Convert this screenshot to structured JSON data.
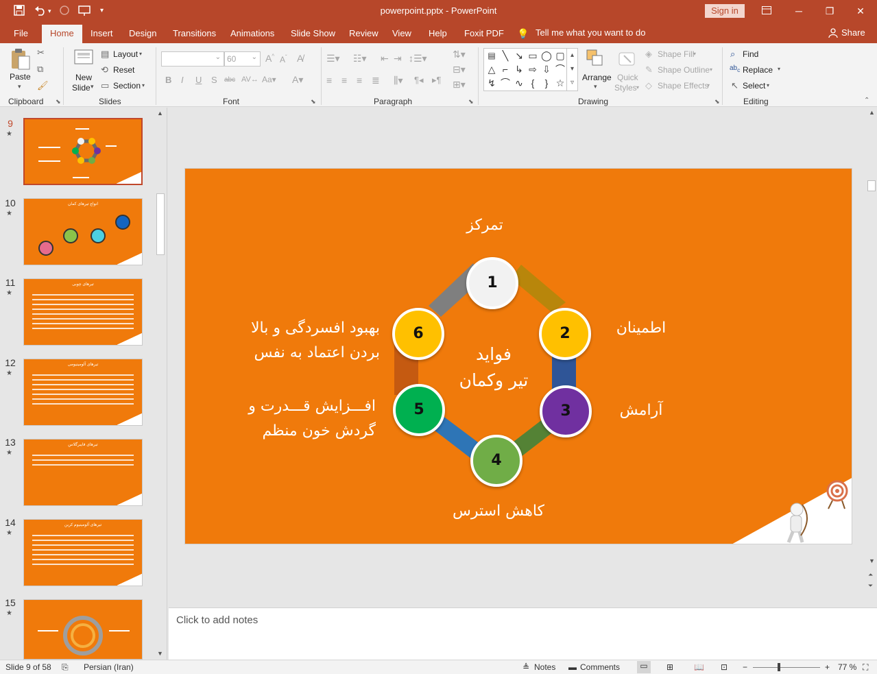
{
  "titlebar": {
    "title": "powerpoint.pptx  -  PowerPoint",
    "sign_in": "Sign in",
    "qat": {
      "save": "save-icon",
      "undo": "undo-icon",
      "redo": "redo-icon",
      "present": "present-icon",
      "more": "customize-icon"
    }
  },
  "tabs": [
    "File",
    "Home",
    "Insert",
    "Design",
    "Transitions",
    "Animations",
    "Slide Show",
    "Review",
    "View",
    "Help",
    "Foxit PDF"
  ],
  "active_tab": "Home",
  "tell_me": "Tell me what you want to do",
  "share": "Share",
  "ribbon": {
    "clipboard": {
      "label": "Clipboard",
      "paste": "Paste"
    },
    "slides": {
      "label": "Slides",
      "new_slide_1": "New",
      "new_slide_2": "Slide",
      "layout": "Layout",
      "reset": "Reset",
      "section": "Section"
    },
    "font": {
      "label": "Font",
      "font_size": "60"
    },
    "paragraph": {
      "label": "Paragraph"
    },
    "drawing": {
      "label": "Drawing",
      "arrange": "Arrange",
      "quick_styles_1": "Quick",
      "quick_styles_2": "Styles",
      "shape_fill": "Shape Fill",
      "shape_outline": "Shape Outline",
      "shape_effects": "Shape Effects"
    },
    "editing": {
      "label": "Editing",
      "find": "Find",
      "replace": "Replace",
      "select": "Select"
    }
  },
  "thumbnails": [
    {
      "num": "9",
      "title": ""
    },
    {
      "num": "10",
      "title": "انواع تیرهای کمان"
    },
    {
      "num": "11",
      "title": "تیرهای چوبی"
    },
    {
      "num": "12",
      "title": "تیرهای آلومینیومی"
    },
    {
      "num": "13",
      "title": "تیرهای فایبرگلاس"
    },
    {
      "num": "14",
      "title": "تیرهای آلومینیوم کربن"
    },
    {
      "num": "15",
      "title": ""
    }
  ],
  "slide": {
    "center_1": "فواید",
    "center_2": "تیر وکمان",
    "label_top": "تمرکز",
    "label_right_1": "اطمینان",
    "label_right_2": "آرامش",
    "label_bottom": "کاهش استرس",
    "label_left_top_1": "بهبود افسردگی و بالا",
    "label_left_top_2": "بردن اعتماد به نفس",
    "label_left_bottom_1": "افـــزایش قـــدرت و",
    "label_left_bottom_2": "گردش خون منظم",
    "nodes": [
      "1",
      "2",
      "3",
      "4",
      "5",
      "6"
    ],
    "node_colors": [
      "#f2f2f2",
      "#ffc000",
      "#7030a0",
      "#70ad47",
      "#00b050",
      "#ffc000"
    ],
    "bg_color": "#f07a0b"
  },
  "notes_placeholder": "Click to add notes",
  "status": {
    "slide_info": "Slide 9 of 58",
    "language": "Persian (Iran)",
    "notes": "Notes",
    "comments": "Comments",
    "zoom": "77 %"
  }
}
